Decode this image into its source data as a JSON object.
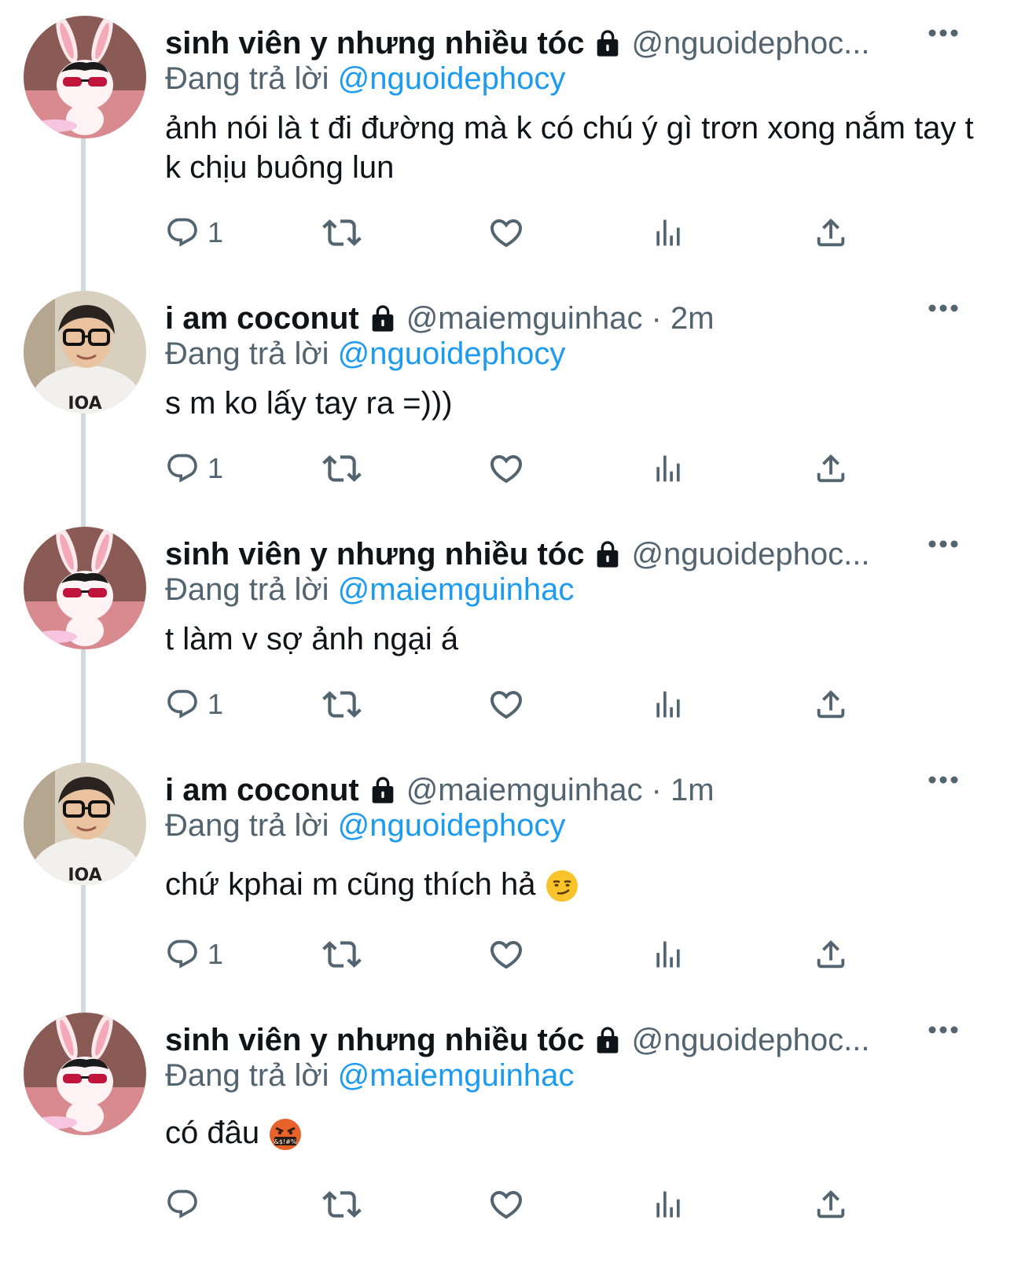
{
  "replying_prefix": "Đang trả lời",
  "tweets": [
    {
      "name": "sinh viên y nhưng nhiều tóc",
      "handle": "@nguoidephoc...",
      "time": "",
      "replying_to": "@nguoidephocy",
      "text": "ảnh nói là t đi đường mà k có chú ý gì trơn xong nắm tay t k chịu buông lun",
      "reply_count": "1",
      "avatar": "bunny-avatar"
    },
    {
      "name": "i am coconut",
      "handle": "@maiemguinhac · 2m",
      "time": "2m",
      "replying_to": "@nguoidephocy",
      "text": "s m ko lấy tay ra =)))",
      "reply_count": "1",
      "avatar": "person-avatar"
    },
    {
      "name": "sinh viên y nhưng nhiều tóc",
      "handle": "@nguoidephoc...",
      "time": "",
      "replying_to": "@maiemguinhac",
      "text": "t làm v sợ ảnh ngại á",
      "reply_count": "1",
      "avatar": "bunny-avatar"
    },
    {
      "name": "i am coconut",
      "handle": "@maiemguinhac · 1m",
      "time": "1m",
      "replying_to": "@nguoidephocy",
      "text": "chứ kphai m cũng thích hả",
      "emoji": "smirk-emoji",
      "reply_count": "1",
      "avatar": "person-avatar"
    },
    {
      "name": "sinh viên y nhưng nhiều tóc",
      "handle": "@nguoidephoc...",
      "time": "",
      "replying_to": "@maiemguinhac",
      "text": "có đâu",
      "emoji": "cursing-face-emoji",
      "reply_count": "",
      "avatar": "bunny-avatar"
    }
  ],
  "colors": {
    "text": "#0f1419",
    "secondary": "#536471",
    "link": "#1d9bf0",
    "thread_line": "#cfd9de"
  },
  "icons": [
    "reply-icon",
    "retweet-icon",
    "like-icon",
    "analytics-icon",
    "share-icon",
    "lock-icon",
    "more-icon"
  ]
}
